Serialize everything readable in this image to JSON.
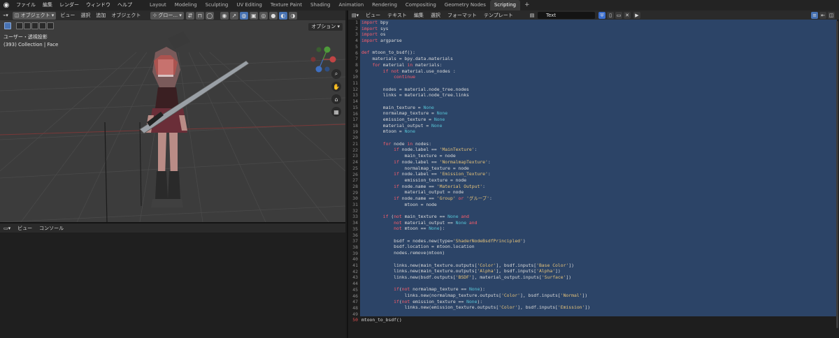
{
  "topbar": {
    "menus": [
      "ファイル",
      "編集",
      "レンダー",
      "ウィンドウ",
      "ヘルプ"
    ],
    "tabs": [
      "Layout",
      "Modeling",
      "Sculpting",
      "UV Editing",
      "Texture Paint",
      "Shading",
      "Animation",
      "Rendering",
      "Compositing",
      "Geometry Nodes",
      "Scripting",
      "+"
    ],
    "active_tab": "Scripting"
  },
  "viewport": {
    "mode": "オブジェクト",
    "menus": [
      "ビュー",
      "選択",
      "追加",
      "オブジェクト"
    ],
    "transform_orientation": "グロー...",
    "info_line1": "ユーザー・透視投影",
    "info_line2": "(393) Collection | Face",
    "options_label": "オプション ▾"
  },
  "console": {
    "menus": [
      "ビュー",
      "コンソール"
    ]
  },
  "text_editor": {
    "menus": [
      "ビュー",
      "テキスト",
      "編集",
      "選択",
      "フォーマット",
      "テンプレート"
    ],
    "text_name": "Text",
    "current_line": 50,
    "lines": [
      "import bpy",
      "import sys",
      "import os",
      "import argparse",
      "",
      "def mtoon_to_bsdf():",
      "    materials = bpy.data.materials",
      "    for material in materials:",
      "        if not material.use_nodes :",
      "            continue",
      "",
      "        nodes = material.node_tree.nodes",
      "        links = material.node_tree.links",
      "",
      "        main_texture = None",
      "        normalmap_texture = None",
      "        emission_texture = None",
      "        material_output = None",
      "        mtoon = None",
      "",
      "        for node in nodes:",
      "            if node.label == 'MainTexture':",
      "                main_texture = node",
      "            if node.label == 'NormalmapTexture':",
      "                normalmap_texture = node",
      "            if node.label == 'Emission_Texture':",
      "                emission_texture = node",
      "            if node.name == 'Material Output':",
      "                material_output = node",
      "            if node.name == 'Group' or 'グループ':",
      "                mtoon = node",
      "",
      "        if (not main_texture == None and",
      "            not material_output == None and",
      "            not mtoon == None):",
      "",
      "            bsdf = nodes.new(type='ShaderNodeBsdfPrincipled')",
      "            bsdf.location = mtoon.location",
      "            nodes.remove(mtoon)",
      "",
      "            links.new(main_texture.outputs['Color'], bsdf.inputs['Base Color'])",
      "            links.new(main_texture.outputs['Alpha'], bsdf.inputs['Alpha'])",
      "            links.new(bsdf.outputs['BSDF'], material_output.inputs['Surface'])",
      "",
      "            if(not normalmap_texture == None):",
      "                links.new(normalmap_texture.outputs['Color'], bsdf.inputs['Normal'])",
      "            if(not emission_texture == None):",
      "                links.new(emission_texture.outputs['Color'], bsdf.inputs['Emission'])",
      "",
      "mtoon_to_bsdf()"
    ]
  },
  "icons": [
    "blender-logo-icon",
    "gizmo-x-icon",
    "gizmo-y-icon",
    "gizmo-z-icon",
    "zoom-icon",
    "hand-pan-icon",
    "camera-icon",
    "grid-view-icon"
  ],
  "colors": {
    "accent": "#4772b3",
    "selection": "#2c4467",
    "keyword": "#ff5e6b",
    "builtin": "#57c4d6",
    "string": "#e8c47a"
  }
}
